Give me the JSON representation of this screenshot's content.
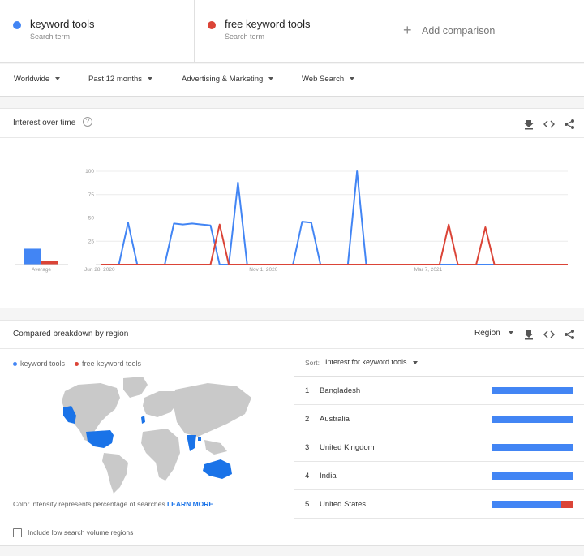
{
  "terms": [
    {
      "name": "keyword tools",
      "subtitle": "Search term",
      "color": "#4285f4"
    },
    {
      "name": "free keyword tools",
      "subtitle": "Search term",
      "color": "#db4437"
    }
  ],
  "add_comparison": {
    "label": "Add comparison"
  },
  "filters": {
    "region": "Worldwide",
    "time": "Past 12 months",
    "category": "Advertising & Marketing",
    "search_type": "Web Search"
  },
  "interest_over_time": {
    "title": "Interest over time",
    "help_icon": "?",
    "average_label": "Average"
  },
  "chart_data": {
    "type": "line",
    "title": "Interest over time",
    "xlabel": "",
    "ylabel": "",
    "ylim": [
      0,
      100
    ],
    "yticks": [
      100,
      75,
      50,
      25
    ],
    "x_tick_labels": [
      "Jun 28, 2020",
      "Nov 1, 2020",
      "Mar 7, 2021"
    ],
    "x_tick_index": [
      0,
      18,
      36
    ],
    "grid": true,
    "series": [
      {
        "name": "keyword tools",
        "color": "#4285f4",
        "average": 17,
        "values": [
          0,
          0,
          0,
          45,
          0,
          0,
          0,
          0,
          44,
          43,
          44,
          43,
          42,
          0,
          0,
          88,
          0,
          0,
          0,
          0,
          0,
          0,
          46,
          45,
          0,
          0,
          0,
          0,
          100,
          0,
          0,
          0,
          0,
          0,
          0,
          0,
          0,
          0,
          0,
          0,
          0,
          0,
          0,
          0,
          0,
          0,
          0,
          0,
          0,
          0,
          0,
          0
        ]
      },
      {
        "name": "free keyword tools",
        "color": "#db4437",
        "average": 4,
        "values": [
          0,
          0,
          0,
          0,
          0,
          0,
          0,
          0,
          0,
          0,
          0,
          0,
          0,
          43,
          0,
          0,
          0,
          0,
          0,
          0,
          0,
          0,
          0,
          0,
          0,
          0,
          0,
          0,
          0,
          0,
          0,
          0,
          0,
          0,
          0,
          0,
          0,
          0,
          43,
          0,
          0,
          0,
          40,
          0,
          0,
          0,
          0,
          0,
          0,
          0,
          0,
          0
        ]
      }
    ]
  },
  "breakdown": {
    "title": "Compared breakdown by region",
    "view": "Region",
    "legend": [
      "keyword tools",
      "free keyword tools"
    ],
    "map_note": "Color intensity represents percentage of searches",
    "learn_more": "LEARN MORE",
    "sort_label": "Sort:",
    "sort_value": "Interest for keyword tools",
    "rows": [
      {
        "rank": "1",
        "country": "Bangladesh",
        "share_a": 1.0,
        "share_b": 0.0
      },
      {
        "rank": "2",
        "country": "Australia",
        "share_a": 1.0,
        "share_b": 0.0
      },
      {
        "rank": "3",
        "country": "United Kingdom",
        "share_a": 1.0,
        "share_b": 0.0
      },
      {
        "rank": "4",
        "country": "India",
        "share_a": 1.0,
        "share_b": 0.0
      },
      {
        "rank": "5",
        "country": "United States",
        "share_a": 0.86,
        "share_b": 0.14
      }
    ],
    "low_volume_label": "Include low search volume regions"
  }
}
